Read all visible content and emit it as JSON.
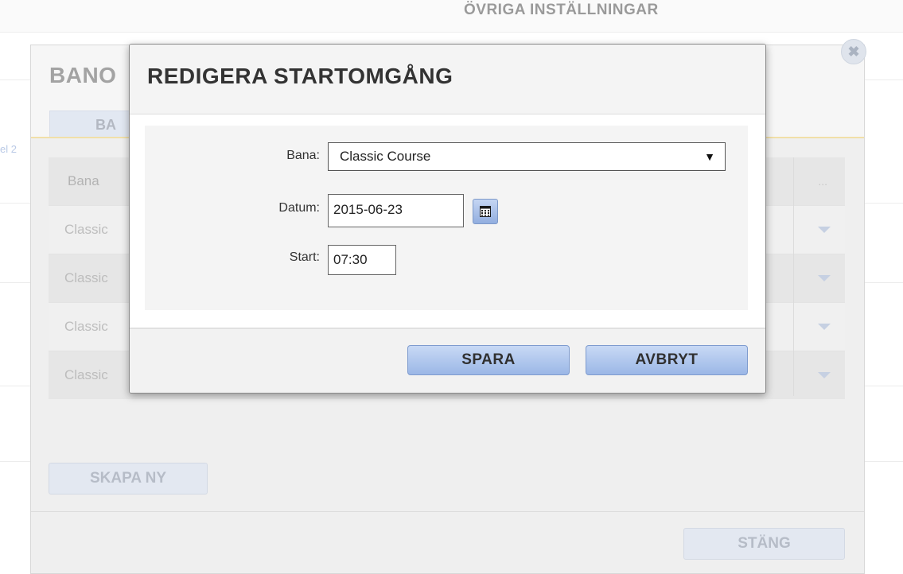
{
  "background": {
    "section_title": "ÖVRIGA INSTÄLLNINGAR",
    "left_fragment": "el 2",
    "modal_title": "BANO",
    "tab_label": "BA",
    "close_icon": "close-icon",
    "table": {
      "header": "Bana",
      "header_actions": "...",
      "rows": [
        "Classic",
        "Classic",
        "Classic",
        "Classic"
      ]
    },
    "create_button": "SKAPA NY",
    "close_button": "STÄNG"
  },
  "dialog": {
    "title": "REDIGERA STARTOMGÅNG",
    "fields": {
      "bana_label": "Bana:",
      "bana_value": "Classic Course",
      "bana_arrow": "▼",
      "datum_label": "Datum:",
      "datum_value": "2015-06-23",
      "calendar_icon": "calendar-icon",
      "start_label": "Start:",
      "start_value": "07:30"
    },
    "buttons": {
      "save": "SPARA",
      "cancel": "AVBRYT"
    }
  },
  "colors": {
    "button_top": "#c8d9f5",
    "button_bottom": "#9bb7e6",
    "title_text": "#333333",
    "accent_line": "#f1dfa8"
  }
}
